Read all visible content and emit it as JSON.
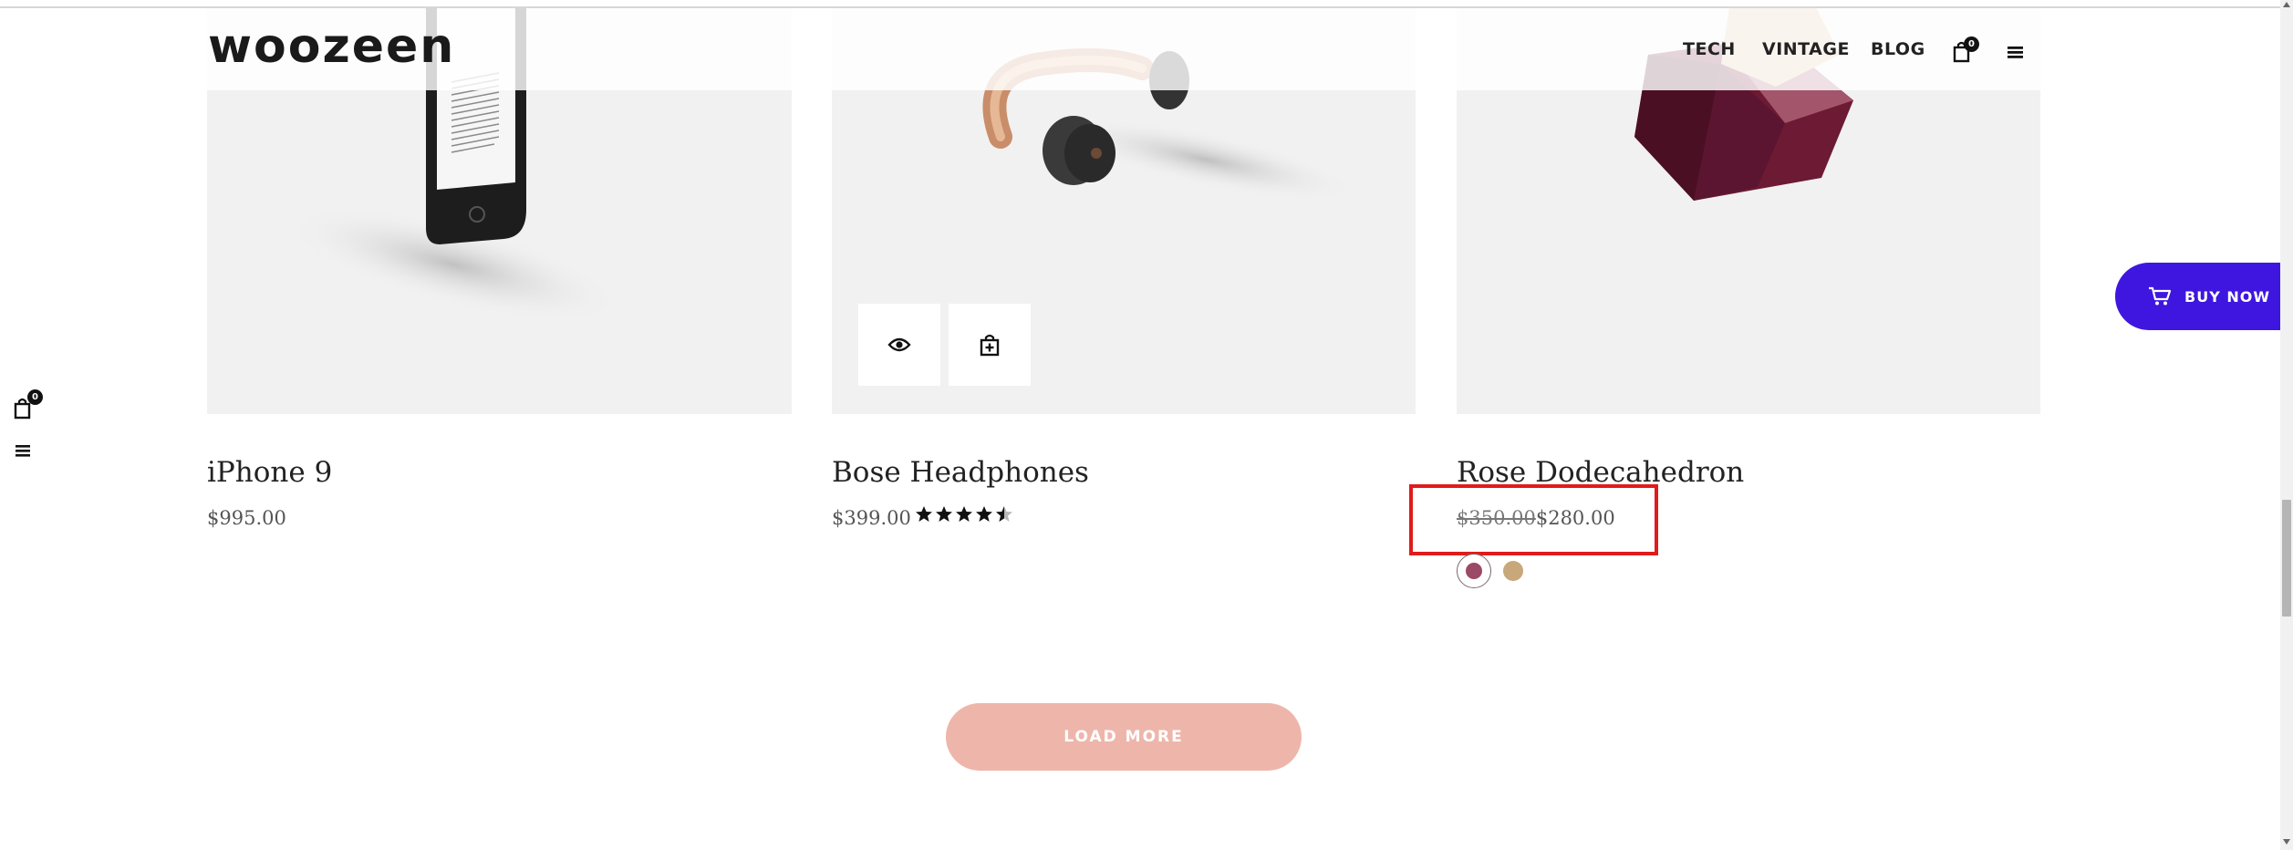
{
  "header": {
    "logo": "woozeen",
    "nav": [
      "TECH",
      "VINTAGE",
      "BLOG"
    ],
    "cart_count": "0"
  },
  "side": {
    "cart_count": "0"
  },
  "products": [
    {
      "name": "iPhone 9",
      "price": "$995.00"
    },
    {
      "name": "Bose Headphones",
      "price": "$399.00",
      "rating": 4.5
    },
    {
      "name": "Rose Dodecahedron",
      "old_price": "$350.00",
      "new_price": "$280.00",
      "swatches": [
        "#9a4a66",
        "#c8a77a"
      ]
    }
  ],
  "load_more": "LOAD MORE",
  "buy_now": "BUY NOW",
  "colors": {
    "accent": "#3f16e0",
    "load_more_bg": "#eeb6ab",
    "highlight": "#e01b1b"
  }
}
